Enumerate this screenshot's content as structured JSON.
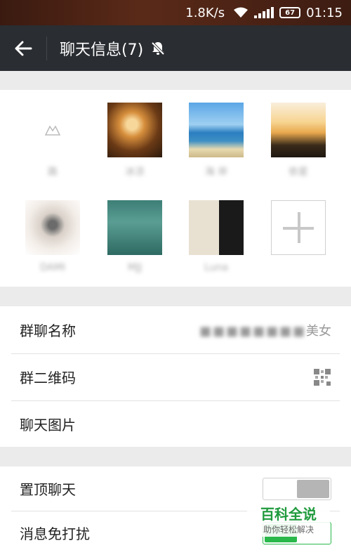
{
  "status_bar": {
    "speed": "1.8K/s",
    "battery": "67",
    "time": "01:15"
  },
  "header": {
    "title": "聊天信息(7)",
    "back_icon": "arrow-left-icon",
    "mute_icon": "bell-off-icon"
  },
  "members": [
    {
      "name": "路",
      "avatar": "blank-placeholder"
    },
    {
      "name": "冰凉",
      "avatar": "tunnel-photo"
    },
    {
      "name": "海 岸",
      "avatar": "beach-photo"
    },
    {
      "name": "依星",
      "avatar": "sunset-photo"
    },
    {
      "name": "DAMI",
      "avatar": "art-photo"
    },
    {
      "name": "MJJ",
      "avatar": "rain-photo"
    },
    {
      "name": "Luna",
      "avatar": "laptop-photo"
    }
  ],
  "add_member_icon": "plus-icon",
  "group_info": {
    "name_label": "群聊名称",
    "name_value": "美女",
    "name_value_blurred": "■■■■■■■■",
    "qr_label": "群二维码",
    "qr_icon": "qr-code-icon",
    "photos_label": "聊天图片"
  },
  "settings": {
    "pin_label": "置顶聊天",
    "pin_on": false,
    "dnd_label": "消息免打扰",
    "dnd_on": true,
    "toggle_on_color": "#2ab84a"
  },
  "watermark": {
    "title": "百科全说",
    "subtitle": "助你轻松解决"
  }
}
